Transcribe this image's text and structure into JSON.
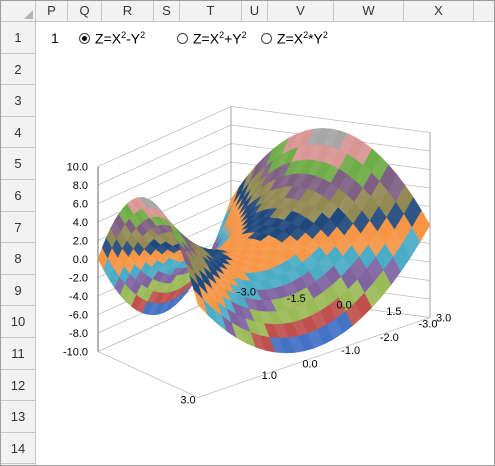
{
  "columns": [
    "P",
    "Q",
    "R",
    "S",
    "T",
    "U",
    "V",
    "W",
    "X"
  ],
  "rows": [
    "1",
    "2",
    "3",
    "4",
    "5",
    "6",
    "7",
    "8",
    "9",
    "10",
    "11",
    "12",
    "13",
    "14"
  ],
  "selector": {
    "index_value": "1",
    "options": [
      {
        "base": "Z=X",
        "exp1": "2",
        "mid": "-Y",
        "exp2": "2",
        "selected": true
      },
      {
        "base": "Z=X",
        "exp1": "2",
        "mid": "+Y",
        "exp2": "2",
        "selected": false
      },
      {
        "base": "Z=X",
        "exp1": "2",
        "mid": "*Y",
        "exp2": "2",
        "selected": false
      }
    ]
  },
  "chart_data": {
    "type": "surface",
    "function": "Z=X^2-Y^2",
    "z_ticks": [
      "10.0",
      "8.0",
      "6.0",
      "4.0",
      "2.0",
      "0.0",
      "-2.0",
      "-4.0",
      "-6.0",
      "-8.0",
      "-10.0"
    ],
    "zlim": [
      -10,
      10
    ],
    "x_ticks": [
      "3.0",
      "1.0",
      "0.0",
      "-1.0",
      "-2.0",
      "-3.0"
    ],
    "y_ticks": [
      "-3.0",
      "-1.5",
      "0.0",
      "1.5",
      "3.0"
    ],
    "xlim": [
      -3,
      3
    ],
    "ylim": [
      -3,
      3
    ],
    "band_colors": [
      "#4472c4",
      "#c0504d",
      "#9bbb59",
      "#8064a2",
      "#4bacc6",
      "#f79646",
      "#1f497d",
      "#938953",
      "#7f6084",
      "#70ad47",
      "#d99694",
      "#a6a6a6"
    ]
  }
}
